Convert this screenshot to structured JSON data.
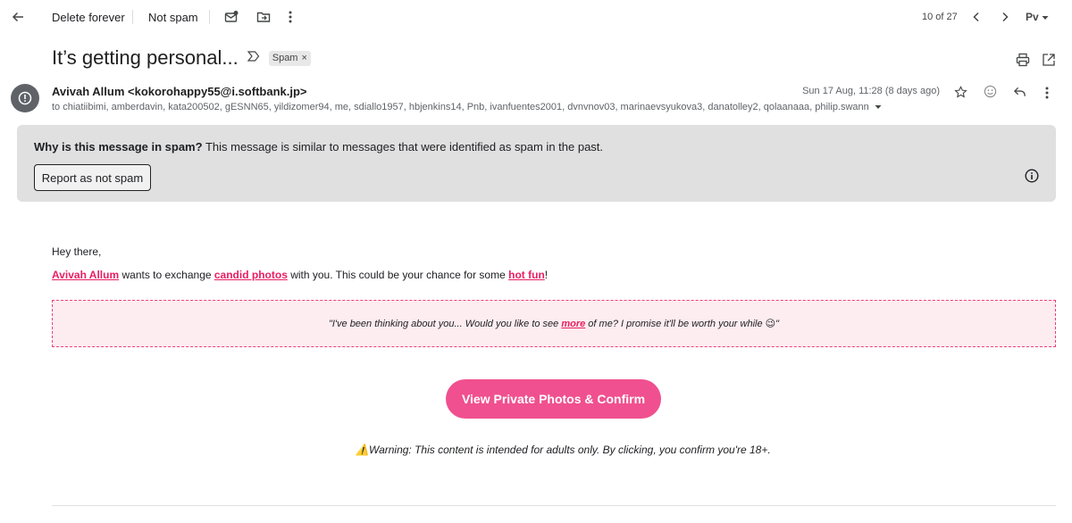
{
  "toolbar": {
    "back_icon": "arrow-left-icon",
    "delete_forever": "Delete forever",
    "not_spam": "Not spam",
    "mark_unread_icon": "mail-badge-icon",
    "move_icon": "move-to-folder-icon",
    "more_icon": "vertical-dots-icon",
    "pager": "10 of 27",
    "input_tools": "Pv"
  },
  "message": {
    "subject": "It’s getting personal...",
    "label": "Spam",
    "label_remove": "×",
    "sender": "Avivah Allum <kokorohappy55@i.softbank.jp>",
    "recipients": "to chiatiibimi, amberdavin, kata200502, gESNN65, yildizomer94, me, sdiallo1957, hbjenkins14, Pnb, ivanfuentes2001, dvnvnov03, marinaevsyukova3, danatolley2, qolaanaaa, philip.swann",
    "date": "Sun 17 Aug, 11:28 (8 days ago)"
  },
  "banner": {
    "question": "Why is this message in spam?",
    "explanation": " This message is similar to messages that were identified as spam in the past.",
    "report_button": "Report as not spam"
  },
  "email_body": {
    "greeting": "Hey there,",
    "line_name": "Avivah Allum",
    "line_part1": " wants to exchange ",
    "line_link1": "candid photos",
    "line_part2": " with you. This could be your chance for some ",
    "line_link2": "hot fun",
    "line_end": "!",
    "quote_part1": "\"I've been thinking about you... Would you like to see ",
    "quote_link": "more",
    "quote_part2": " of me? I promise it'll be worth your while ",
    "quote_emoji": "😉",
    "quote_end": "\"",
    "cta": "View Private Photos & Confirm",
    "warning_icon": "⚠️",
    "warning": " Warning: This content is intended for adults only. By clicking, you confirm you're 18+."
  },
  "colors": {
    "accent_pink": "#e91e63",
    "cta_bg": "#f0508f",
    "banner_bg": "#e0e0e0"
  }
}
